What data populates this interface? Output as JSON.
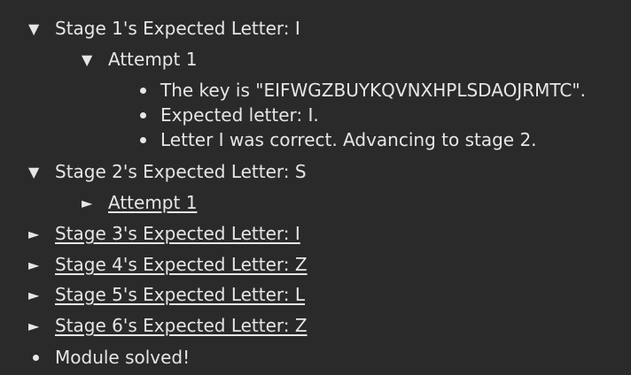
{
  "tree": {
    "stage1": {
      "arrow": "▼",
      "label": "Stage 1's Expected Letter: I",
      "attempt": {
        "arrow": "▼",
        "label": "Attempt 1",
        "bullets": [
          "The key is \"EIFWGZBUYKQVNXHPLSDAOJRMTC\".",
          "Expected letter: I.",
          "Letter I was correct. Advancing to stage 2."
        ]
      }
    },
    "stage2": {
      "arrow": "▼",
      "label": "Stage 2's Expected Letter: S",
      "attempt": {
        "arrow": "►",
        "label": "Attempt 1"
      }
    },
    "stage3": {
      "arrow": "►",
      "label": "Stage 3's Expected Letter: I"
    },
    "stage4": {
      "arrow": "►",
      "label": "Stage 4's Expected Letter: Z"
    },
    "stage5": {
      "arrow": "►",
      "label": "Stage 5's Expected Letter: L"
    },
    "stage6": {
      "arrow": "►",
      "label": "Stage 6's Expected Letter: Z"
    },
    "final": {
      "label": "Module solved!"
    }
  }
}
